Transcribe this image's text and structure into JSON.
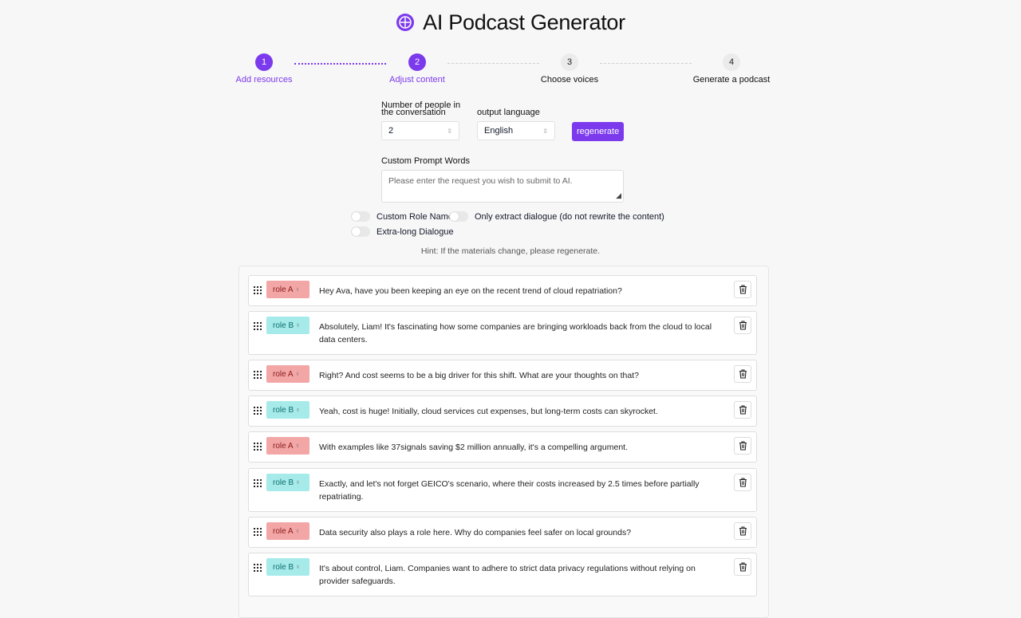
{
  "app": {
    "title": "AI Podcast Generator",
    "logo_icon": "podcast-logo-icon",
    "brand_color": "#7c3aed"
  },
  "steps": [
    {
      "number": "1",
      "label": "Add resources",
      "state": "active"
    },
    {
      "number": "2",
      "label": "Adjust content",
      "state": "active"
    },
    {
      "number": "3",
      "label": "Choose voices",
      "state": "inactive"
    },
    {
      "number": "4",
      "label": "Generate a podcast",
      "state": "inactive"
    }
  ],
  "settings": {
    "people_label_line1": "Number of people in",
    "people_label_line2": "the conversation",
    "people_value": "2",
    "language_label": "output language",
    "language_value": "English",
    "regenerate_label": "regenerate",
    "prompt_label": "Custom Prompt Words",
    "prompt_placeholder": "Please enter the request you wish to submit to AI.",
    "toggles": {
      "custom_role": "Custom Role Name",
      "only_extract": "Only extract dialogue (do not rewrite the content)",
      "extra_long": "Extra-long Dialogue"
    },
    "hint": "Hint: If the materials change, please regenerate."
  },
  "dialogue": [
    {
      "role": "role A",
      "role_type": "a",
      "text": "Hey Ava, have you been keeping an eye on the recent trend of cloud repatriation?"
    },
    {
      "role": "role B",
      "role_type": "b",
      "text": "Absolutely, Liam! It's fascinating how some companies are bringing workloads back from the cloud to local data centers."
    },
    {
      "role": "role A",
      "role_type": "a",
      "text": "Right? And cost seems to be a big driver for this shift. What are your thoughts on that?"
    },
    {
      "role": "role B",
      "role_type": "b",
      "text": "Yeah, cost is huge! Initially, cloud services cut expenses, but long-term costs can skyrocket."
    },
    {
      "role": "role A",
      "role_type": "a",
      "text": "With examples like 37signals saving $2 million annually, it's a compelling argument."
    },
    {
      "role": "role B",
      "role_type": "b",
      "text": "Exactly, and let's not forget GEICO's scenario, where their costs increased by 2.5 times before partially repatriating."
    },
    {
      "role": "role A",
      "role_type": "a",
      "text": "Data security also plays a role here. Why do companies feel safer on local grounds?"
    },
    {
      "role": "role B",
      "role_type": "b",
      "text": "It's about control, Liam. Companies want to adhere to strict data privacy regulations without relying on provider safeguards."
    }
  ]
}
